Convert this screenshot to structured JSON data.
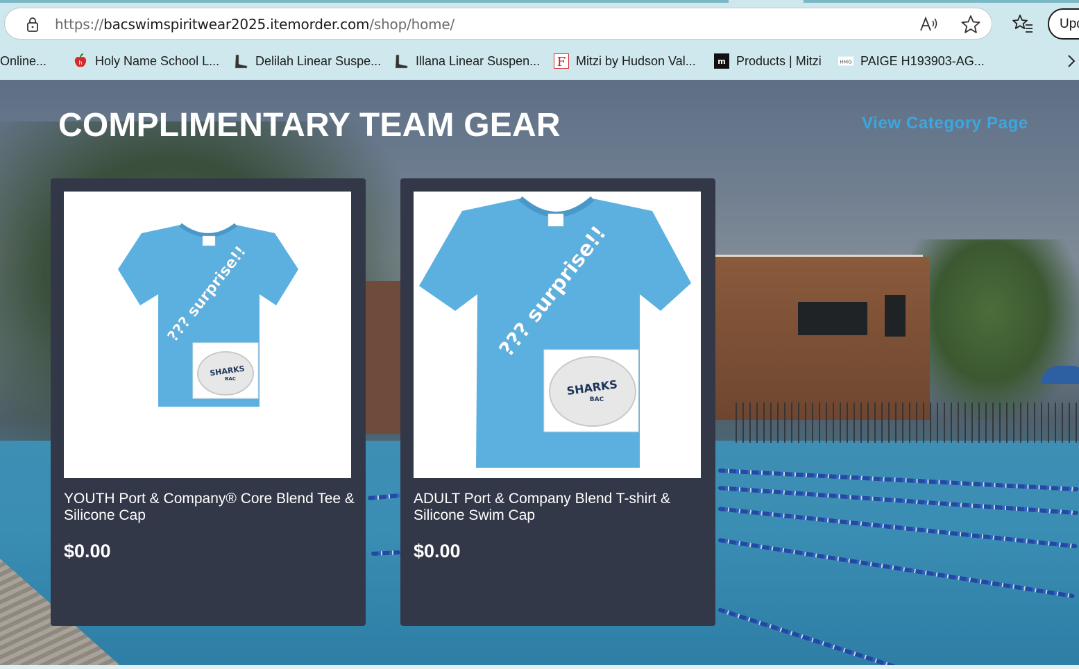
{
  "browser": {
    "url_prefix": "https://",
    "url_domain": "bacswimspiritwear2025.itemorder.com",
    "url_path": "/shop/home/",
    "update_button_label": "Upd",
    "bookmarks": [
      {
        "label": "Online...",
        "icon": "none"
      },
      {
        "label": "Holy Name School L...",
        "icon": "apple-icon"
      },
      {
        "label": "Delilah Linear Suspe...",
        "icon": "boot-icon"
      },
      {
        "label": "Illana Linear Suspen...",
        "icon": "boot-icon"
      },
      {
        "label": "Mitzi by Hudson Val...",
        "icon": "letter-f-icon"
      },
      {
        "label": "Products | Mitzi",
        "icon": "mitzi-m-icon"
      },
      {
        "label": "PAIGE H193903-AG...",
        "icon": "hmg-icon"
      }
    ]
  },
  "page": {
    "section_title": "COMPLIMENTARY TEAM GEAR",
    "view_category_label": "View Category Page",
    "products": [
      {
        "name": "YOUTH Port & Company® Core Blend Tee & Silicone Cap",
        "price": "$0.00",
        "shirt_text": "??? surprise!!",
        "cap_text": "SHARKS",
        "cap_subtext": "BAC"
      },
      {
        "name": "ADULT Port & Company Blend T-shirt & Silicone Swim Cap",
        "price": "$0.00",
        "shirt_text": "??? surprise!!",
        "cap_text": "SHARKS",
        "cap_subtext": "BAC"
      }
    ]
  },
  "colors": {
    "card_bg": "#333848",
    "link": "#3aa8e0",
    "shirt": "#5cb0e0",
    "chrome": "#cfe8ee"
  }
}
